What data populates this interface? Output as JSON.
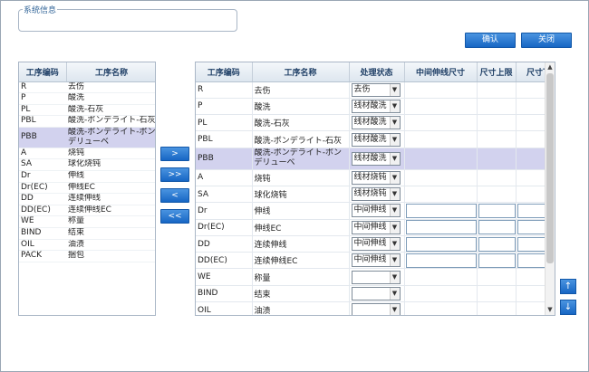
{
  "system_info": {
    "label": "系统信息"
  },
  "buttons": {
    "confirm": "确认",
    "close": "关闭",
    "move_right": ">",
    "move_all_right": ">>",
    "move_left": "<",
    "move_all_left": "<<",
    "up": "↑",
    "down": "↓"
  },
  "left_table": {
    "headers": [
      "工序编码",
      "工序名称"
    ],
    "rows": [
      {
        "code": "R",
        "name": "去伤"
      },
      {
        "code": "P",
        "name": "酸洗"
      },
      {
        "code": "PL",
        "name": "酸洗-石灰"
      },
      {
        "code": "PBL",
        "name": "酸洗-ボンデライト-石灰"
      },
      {
        "code": "PBB",
        "name": "酸洗-ボンデライト-ボンデリューベ"
      },
      {
        "code": "A",
        "name": "烧钝"
      },
      {
        "code": "SA",
        "name": "球化烧钝"
      },
      {
        "code": "Dr",
        "name": "伸线"
      },
      {
        "code": "Dr(EC)",
        "name": "伸线EC"
      },
      {
        "code": "DD",
        "name": "连续伸线"
      },
      {
        "code": "DD(EC)",
        "name": "连续伸线EC"
      },
      {
        "code": "WE",
        "name": "称量"
      },
      {
        "code": "BIND",
        "name": "结束"
      },
      {
        "code": "OIL",
        "name": "油渍"
      },
      {
        "code": "PACK",
        "name": "捆包"
      }
    ],
    "selected_code": "PBB"
  },
  "right_table": {
    "headers": [
      "工序编码",
      "工序名称",
      "处理状态",
      "中间伸线尺寸",
      "尺寸上限",
      "尺寸下"
    ],
    "rows": [
      {
        "code": "R",
        "name": "去伤",
        "status": "去伤",
        "inputs": false
      },
      {
        "code": "P",
        "name": "酸洗",
        "status": "线材酸洗",
        "inputs": false
      },
      {
        "code": "PL",
        "name": "酸洗-石灰",
        "status": "线材酸洗",
        "inputs": false
      },
      {
        "code": "PBL",
        "name": "酸洗-ボンデライト-石灰",
        "status": "线材酸洗",
        "inputs": false
      },
      {
        "code": "PBB",
        "name": "酸洗-ボンデライト-ボンデリューベ",
        "status": "线材酸洗",
        "inputs": false
      },
      {
        "code": "A",
        "name": "烧钝",
        "status": "线材烧钝",
        "inputs": false
      },
      {
        "code": "SA",
        "name": "球化烧钝",
        "status": "线材烧钝",
        "inputs": false
      },
      {
        "code": "Dr",
        "name": "伸线",
        "status": "中间伸线",
        "inputs": true
      },
      {
        "code": "Dr(EC)",
        "name": "伸线EC",
        "status": "中间伸线",
        "inputs": true
      },
      {
        "code": "DD",
        "name": "连续伸线",
        "status": "中间伸线",
        "inputs": true
      },
      {
        "code": "DD(EC)",
        "name": "连续伸线EC",
        "status": "中间伸线",
        "inputs": true
      },
      {
        "code": "WE",
        "name": "称量",
        "status": "",
        "inputs": false
      },
      {
        "code": "BIND",
        "name": "结束",
        "status": "",
        "inputs": false
      },
      {
        "code": "OIL",
        "name": "油渍",
        "status": "",
        "inputs": false
      }
    ],
    "selected_code": "PBB"
  }
}
